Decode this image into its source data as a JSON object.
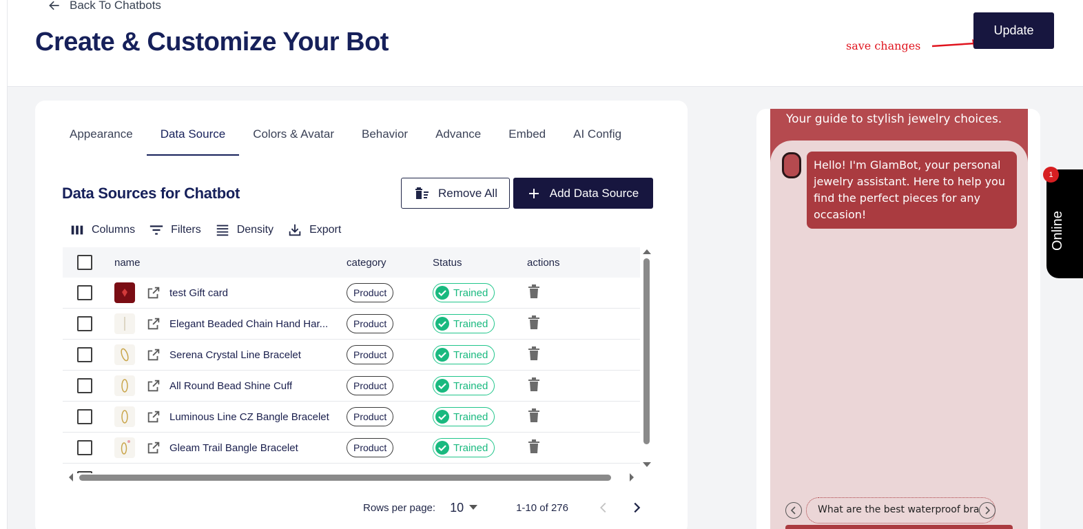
{
  "header": {
    "back_label": "Back To Chatbots",
    "title": "Create & Customize Your Bot",
    "update_label": "Update",
    "annotation": "save changes"
  },
  "tabs": [
    {
      "label": "Appearance"
    },
    {
      "label": "Data Source",
      "active": true
    },
    {
      "label": "Colors & Avatar"
    },
    {
      "label": "Behavior"
    },
    {
      "label": "Advance"
    },
    {
      "label": "Embed"
    },
    {
      "label": "AI Config"
    }
  ],
  "data_sources": {
    "title": "Data Sources for Chatbot",
    "remove_all_label": "Remove All",
    "add_label": "Add Data Source",
    "toolbar": {
      "columns": "Columns",
      "filters": "Filters",
      "density": "Density",
      "export": "Export"
    },
    "columns": {
      "name": "name",
      "category": "category",
      "status": "Status",
      "actions": "actions"
    },
    "rows": [
      {
        "name": "test Gift card",
        "category": "Product",
        "status": "Trained"
      },
      {
        "name": "Elegant Beaded Chain Hand Har...",
        "category": "Product",
        "status": "Trained"
      },
      {
        "name": "Serena Crystal Line Bracelet",
        "category": "Product",
        "status": "Trained"
      },
      {
        "name": "All Round Bead Shine Cuff",
        "category": "Product",
        "status": "Trained"
      },
      {
        "name": "Luminous Line CZ Bangle Bracelet",
        "category": "Product",
        "status": "Trained"
      },
      {
        "name": "Gleam Trail Bangle Bracelet",
        "category": "Product",
        "status": "Trained"
      }
    ],
    "pagination": {
      "rows_per_page_label": "Rows per page:",
      "rows_per_page": "10",
      "range": "1-10 of 276"
    }
  },
  "chat_preview": {
    "subtitle": "Your guide to stylish jewelry choices.",
    "greeting": "Hello! I'm GlamBot, your personal jewelry assistant. Here to help you find the perfect pieces for any occasion!",
    "suggestion": "What are the best waterproof bracelets",
    "online_label": "Online",
    "notification_count": "1"
  },
  "colors": {
    "primary": "#17163f",
    "chat_accent": "#aa3b40",
    "trained": "#19b97f"
  }
}
